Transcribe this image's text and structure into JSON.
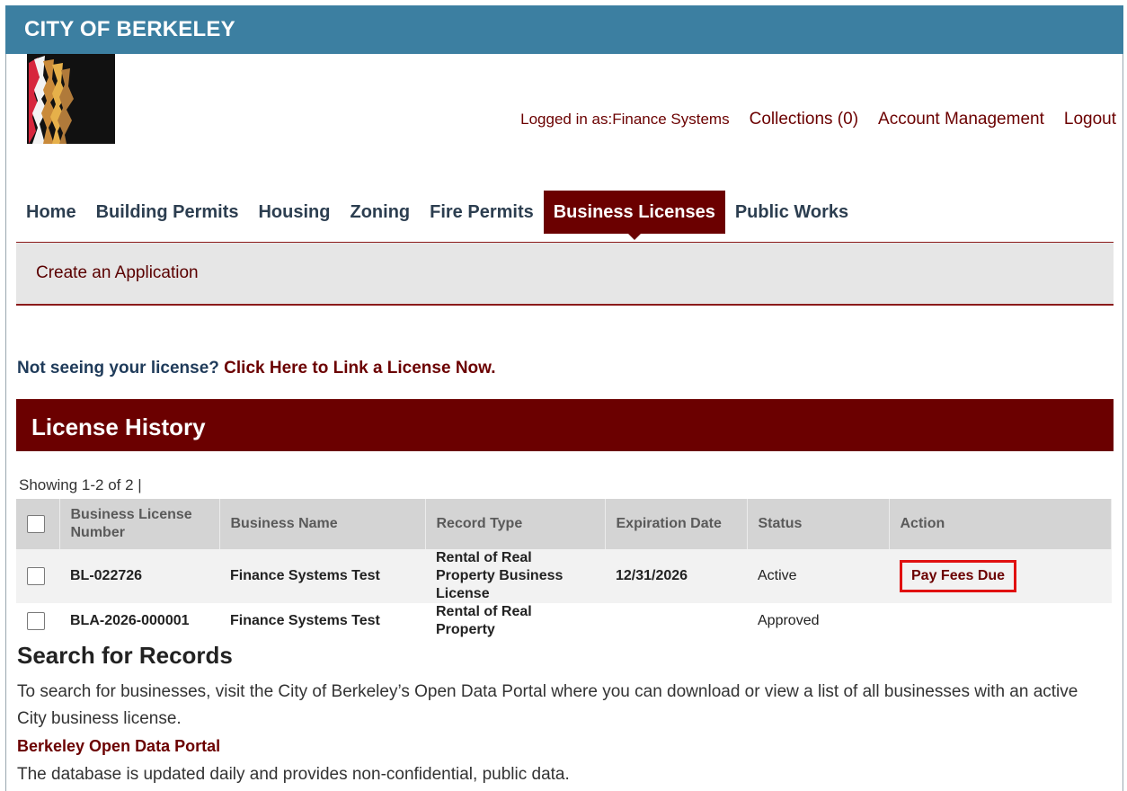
{
  "site": {
    "title": "CITY OF BERKELEY",
    "brand_color": "#3c7fa1",
    "accent_color": "#6b0000",
    "logo_icon": "berkeley-faces-logo"
  },
  "user_nav": {
    "logged_in": "Logged in as:Finance Systems",
    "collections": "Collections (0)",
    "account_management": "Account Management",
    "logout": "Logout"
  },
  "main_nav": {
    "tabs": [
      {
        "label": "Home"
      },
      {
        "label": "Building Permits"
      },
      {
        "label": "Housing"
      },
      {
        "label": "Zoning"
      },
      {
        "label": "Fire Permits"
      },
      {
        "label": "Business Licenses",
        "active": true
      },
      {
        "label": "Public Works"
      }
    ]
  },
  "sub_nav": {
    "create_application": "Create an Application"
  },
  "link_prompt": {
    "question": "Not seeing your license? ",
    "action": "Click Here to Link a License Now."
  },
  "license_history": {
    "title": "License History",
    "showing": "Showing 1-2 of 2 |",
    "columns": [
      "Business License Number",
      "Business Name",
      "Record Type",
      "Expiration Date",
      "Status",
      "Action"
    ],
    "rows": [
      {
        "number": "BL-022726",
        "business_name": "Finance Systems Test",
        "record_type": "Rental of Real Property Business License",
        "expiration": "12/31/2026",
        "status": "Active",
        "action": "Pay Fees Due"
      },
      {
        "number": "BLA-2026-000001",
        "business_name": "Finance Systems Test",
        "record_type": "Rental of Real Property",
        "expiration": "",
        "status": "Approved",
        "action": ""
      }
    ]
  },
  "search": {
    "title": "Search for Records",
    "description": "To search for businesses, visit the City of Berkeley’s Open Data Portal where you can download or view a list of all businesses with an active City business license.",
    "portal_link": "Berkeley Open Data Portal",
    "note": "The database is updated daily and provides non-confidential, public data."
  }
}
